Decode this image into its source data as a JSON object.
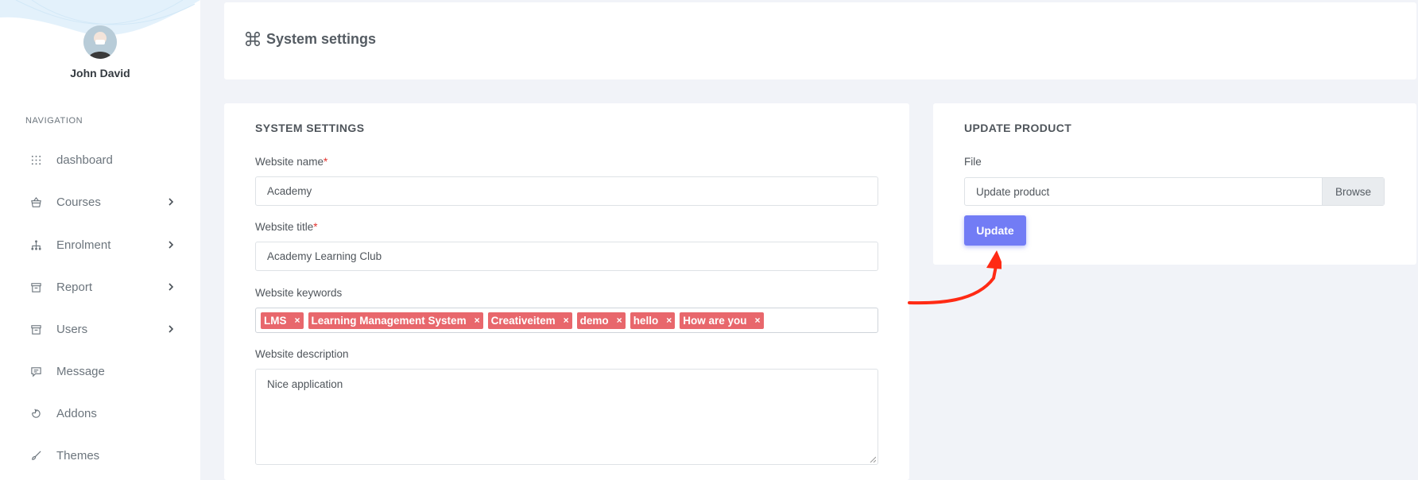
{
  "profile": {
    "name": "John David"
  },
  "nav": {
    "heading": "NAVIGATION",
    "items": [
      {
        "label": "dashboard",
        "icon": "grid-icon",
        "has_children": false
      },
      {
        "label": "Courses",
        "icon": "basket-icon",
        "has_children": true
      },
      {
        "label": "Enrolment",
        "icon": "sitemap-icon",
        "has_children": true
      },
      {
        "label": "Report",
        "icon": "archive-icon",
        "has_children": true
      },
      {
        "label": "Users",
        "icon": "archive-icon",
        "has_children": true
      },
      {
        "label": "Message",
        "icon": "chat-icon",
        "has_children": false
      },
      {
        "label": "Addons",
        "icon": "puzzle-icon",
        "has_children": false
      },
      {
        "label": "Themes",
        "icon": "brush-icon",
        "has_children": false
      }
    ]
  },
  "header": {
    "title": "System settings",
    "icon": "command-icon"
  },
  "system_settings": {
    "title": "SYSTEM SETTINGS",
    "website_name": {
      "label": "Website name",
      "required": "*",
      "value": "Academy"
    },
    "website_title": {
      "label": "Website title",
      "required": "*",
      "value": "Academy Learning Club"
    },
    "website_keywords": {
      "label": "Website keywords",
      "tags": [
        "LMS",
        "Learning Management System",
        "Creativeitem",
        "demo",
        "hello",
        "How are you"
      ],
      "remove_symbol": "×"
    },
    "website_description": {
      "label": "Website description",
      "value": "Nice application"
    }
  },
  "update_product": {
    "title": "UPDATE PRODUCT",
    "file_label": "File",
    "file_placeholder": "Update product",
    "browse_label": "Browse",
    "update_button": "Update"
  },
  "colors": {
    "accent": "#727cf5",
    "tag": "#e8676c",
    "required": "#e3342f",
    "annotation_arrow": "#ff2a14"
  }
}
